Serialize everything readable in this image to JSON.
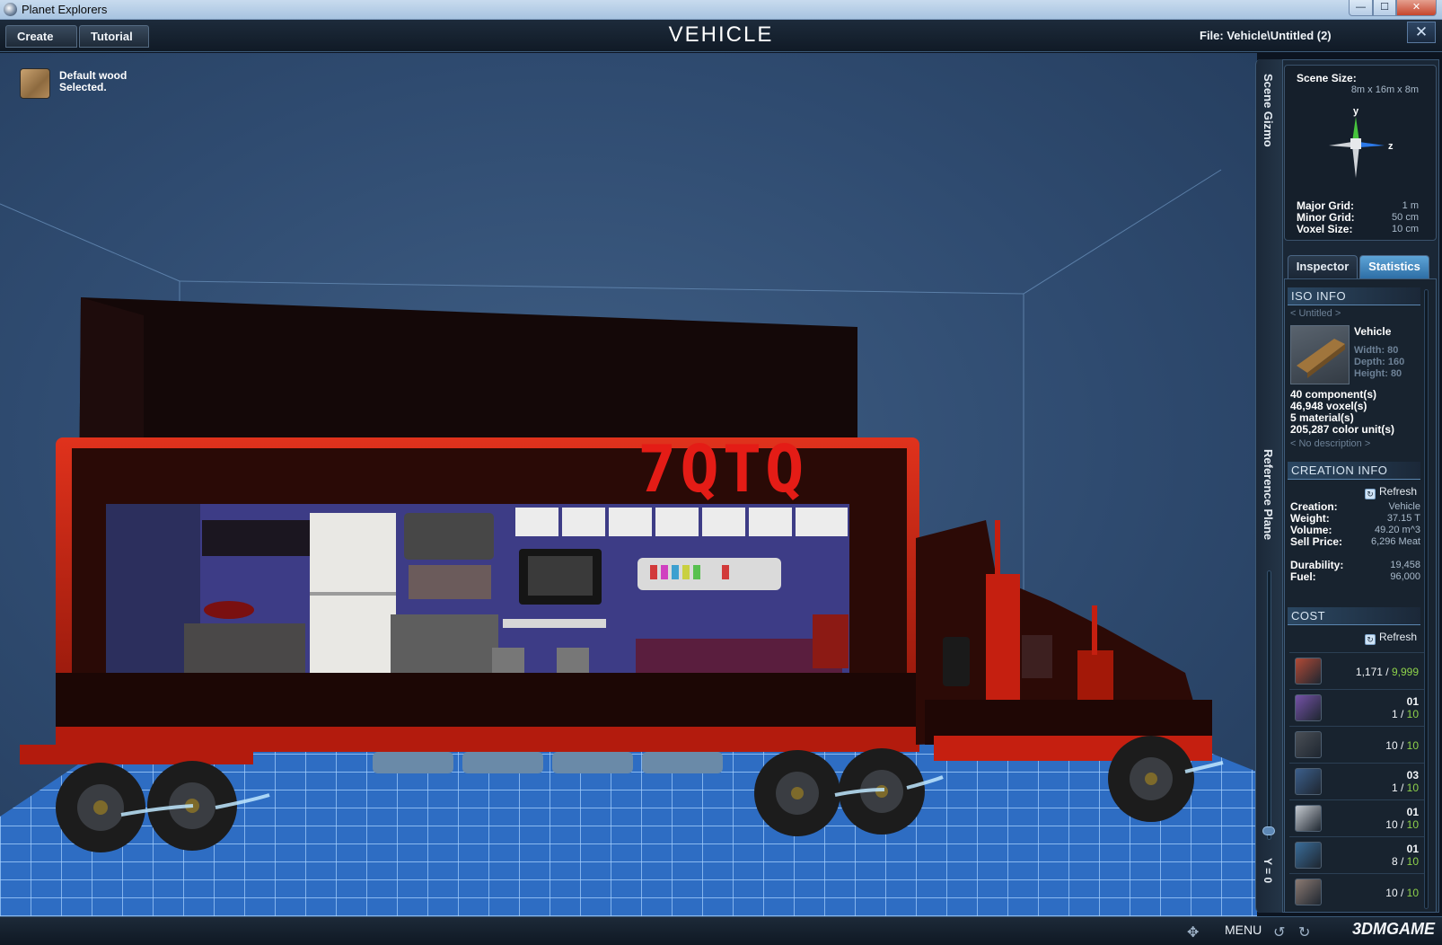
{
  "os": {
    "title": "Planet Explorers",
    "min": "—",
    "max": "☐",
    "close": "✕"
  },
  "header": {
    "create": "Create",
    "tutorial": "Tutorial",
    "title": "VEHICLE",
    "file": "File:  Vehicle\\Untitled (2)",
    "close": "✕"
  },
  "viewport": {
    "material_line1": "Default wood",
    "material_line2": "Selected.",
    "sign_text": "7QTQ"
  },
  "strip": {
    "scene_gizmo": "Scene Gizmo",
    "reference_plane": "Reference Plane",
    "y_value": "Y = 0"
  },
  "gizmo": {
    "scene_size_label": "Scene Size:",
    "scene_size_value": "8m x 16m x 8m",
    "axis_y": "y",
    "axis_z": "z",
    "major_grid_label": "Major Grid:",
    "major_grid_value": "1 m",
    "minor_grid_label": "Minor Grid:",
    "minor_grid_value": "50 cm",
    "voxel_size_label": "Voxel Size:",
    "voxel_size_value": "10 cm"
  },
  "tabs": {
    "inspector": "Inspector",
    "statistics": "Statistics"
  },
  "iso_info": {
    "heading": "ISO INFO",
    "name": "< Untitled >",
    "type": "Vehicle",
    "width": "Width: 80",
    "depth": "Depth: 160",
    "height": "Height: 80",
    "components": "40 component(s)",
    "voxels": "46,948 voxel(s)",
    "materials": "5 material(s)",
    "color_units": "205,287 color unit(s)",
    "description": "< No description >"
  },
  "creation_info": {
    "heading": "CREATION INFO",
    "refresh": "Refresh",
    "creation_label": "Creation:",
    "creation_value": "Vehicle",
    "weight_label": "Weight:",
    "weight_value": "37.15 T",
    "volume_label": "Volume:",
    "volume_value": "49.20 m^3",
    "sell_label": "Sell Price:",
    "sell_value": "6,296 Meat",
    "durability_label": "Durability:",
    "durability_value": "19,458",
    "fuel_label": "Fuel:",
    "fuel_value": "96,000"
  },
  "cost": {
    "heading": "COST",
    "refresh": "Refresh",
    "items": [
      {
        "top": "",
        "have": "1,171",
        "sep": " / ",
        "max": "9,999",
        "icon_color": "#b24a36",
        "icon": "wood-block-icon"
      },
      {
        "top": "01",
        "have": "1",
        "sep": " / ",
        "max": "10",
        "icon_color": "#7552a8",
        "icon": "seat-icon"
      },
      {
        "top": "",
        "have": "10",
        "sep": " / ",
        "max": "10",
        "icon_color": "#4a4f56",
        "icon": "wheel-icon"
      },
      {
        "top": "03",
        "have": "1",
        "sep": " / ",
        "max": "10",
        "icon_color": "#3c5f8c",
        "icon": "engine-icon"
      },
      {
        "top": "01",
        "have": "10",
        "sep": " / ",
        "max": "10",
        "icon_color": "#c7ccd2",
        "icon": "headlight-icon"
      },
      {
        "top": "01",
        "have": "8",
        "sep": " / ",
        "max": "10",
        "icon_color": "#3a6d9a",
        "icon": "thruster-icon"
      },
      {
        "top": "",
        "have": "10",
        "sep": " / ",
        "max": "10",
        "icon_color": "#8c7a72",
        "icon": "chair-icon"
      }
    ]
  },
  "bottom": {
    "menu": "MENU",
    "watermark": "3DMGAME"
  }
}
